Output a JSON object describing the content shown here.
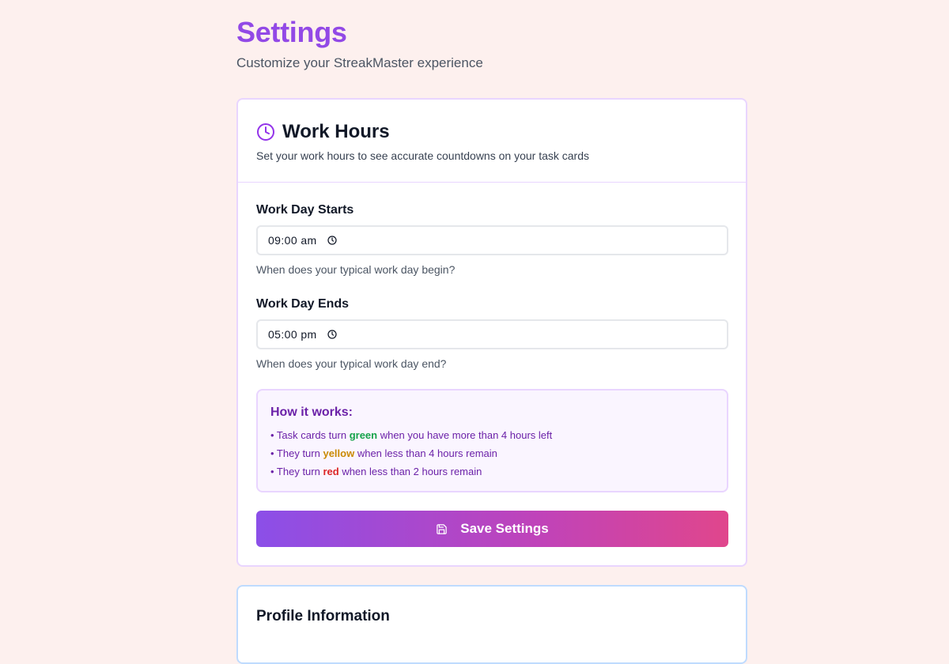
{
  "header": {
    "title": "Settings",
    "subtitle": "Customize your StreakMaster experience"
  },
  "work_hours": {
    "icon": "clock-icon",
    "title": "Work Hours",
    "description": "Set your work hours to see accurate countdowns on your task cards",
    "start": {
      "label": "Work Day Starts",
      "value": "09:00 am",
      "help": "When does your typical work day begin?"
    },
    "end": {
      "label": "Work Day Ends",
      "value": "05:00 pm",
      "help": "When does your typical work day end?"
    },
    "how_it_works": {
      "title": "How it works:",
      "lines": [
        {
          "prefix": "• Task cards turn ",
          "highlight": "green",
          "suffix": " when you have more than 4 hours left",
          "color": "#16a34a"
        },
        {
          "prefix": "• They turn ",
          "highlight": "yellow",
          "suffix": " when less than 4 hours remain",
          "color": "#ca8a04"
        },
        {
          "prefix": "• They turn ",
          "highlight": "red",
          "suffix": " when less than 2 hours remain",
          "color": "#dc2626"
        }
      ]
    },
    "save_label": "Save Settings"
  },
  "profile": {
    "title": "Profile Information"
  },
  "colors": {
    "accent": "#9249e6",
    "gradient_start": "#8b4fe8",
    "gradient_end": "#e0468c",
    "background": "#fdf0ee"
  }
}
